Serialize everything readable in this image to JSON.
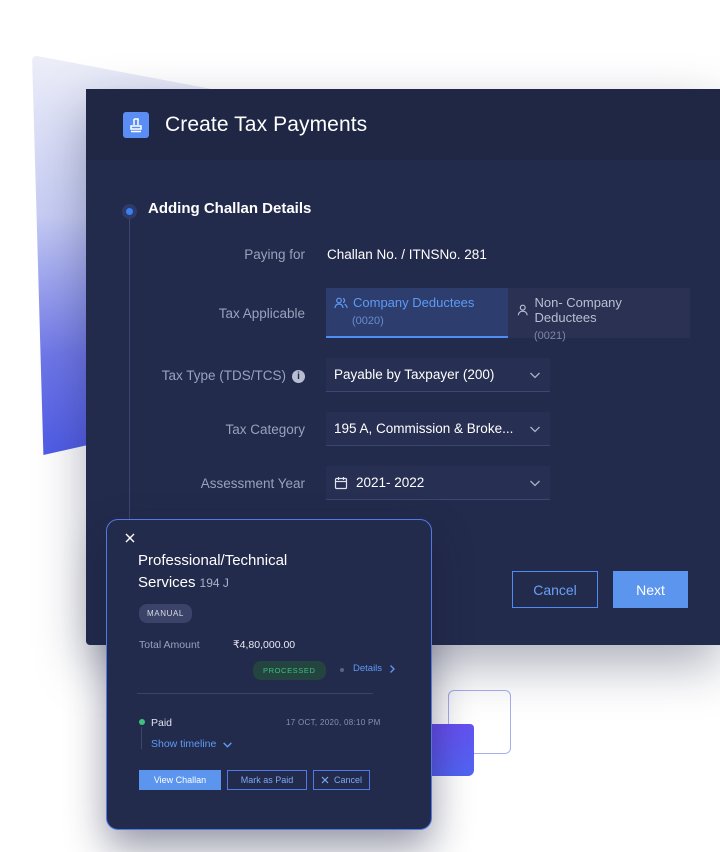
{
  "header": {
    "title": "Create Tax Payments",
    "icon": "stamp-icon"
  },
  "step": {
    "title": "Adding Challan Details"
  },
  "form": {
    "paying_for": {
      "label": "Paying for",
      "value": "Challan No. / ITNSNo. 281"
    },
    "tax_applicable": {
      "label": "Tax Applicable",
      "options": [
        {
          "label": "Company Deductees",
          "code": "(0020)",
          "selected": true
        },
        {
          "label": "Non- Company Deductees",
          "code": "(0021)",
          "selected": false
        }
      ]
    },
    "tax_type": {
      "label": "Tax Type (TDS/TCS)",
      "value": "Payable by Taxpayer (200)",
      "info_glyph": "i"
    },
    "tax_category": {
      "label": "Tax Category",
      "value": "195 A, Commission & Broke..."
    },
    "assessment_year": {
      "label": "Assessment Year",
      "value": "2021- 2022"
    }
  },
  "actions": {
    "cancel": "Cancel",
    "next": "Next"
  },
  "popup": {
    "title": "Professional/Technical Services",
    "code": "194 J",
    "badge": "MANUAL",
    "amount_label": "Total Amount",
    "amount_value": "₹4,80,000.00",
    "status": "PROCESSED",
    "details_link": "Details",
    "paid_label": "Paid",
    "paid_date": "17 OCT, 2020, 08:10 PM",
    "timeline_link": "Show timeline",
    "buttons": {
      "view": "View Challan",
      "mark_paid": "Mark as Paid",
      "cancel": "Cancel"
    }
  },
  "colors": {
    "accent": "#5b95ee",
    "panel": "#232b4c",
    "success": "#3fc07f"
  }
}
